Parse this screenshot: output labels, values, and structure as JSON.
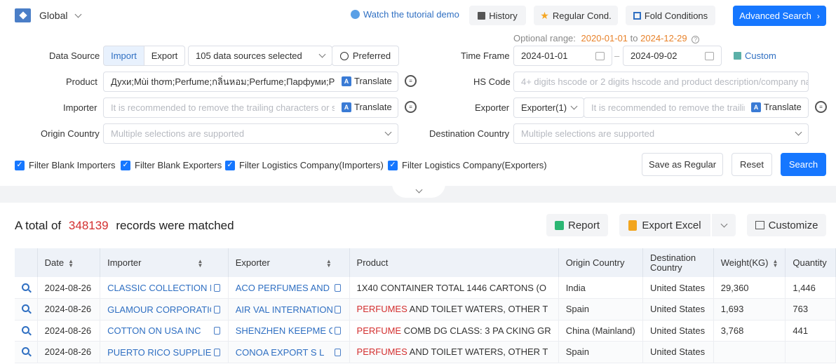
{
  "topbar": {
    "region": "Global",
    "tutorial": "Watch the tutorial demo",
    "history": "History",
    "regular": "Regular Cond.",
    "fold": "Fold Conditions",
    "advanced": "Advanced Search"
  },
  "range": {
    "label": "Optional range:",
    "start": "2020-01-01",
    "to": "to",
    "end": "2024-12-29"
  },
  "form": {
    "data_source_label": "Data Source",
    "import_tab": "Import",
    "export_tab": "Export",
    "sources_selected": "105 data sources selected",
    "preferred": "Preferred",
    "time_frame_label": "Time Frame",
    "date_from": "2024-01-01",
    "date_sep": "–",
    "date_to": "2024-09-02",
    "custom": "Custom",
    "product_label": "Product",
    "product_value": "Духи;Mùi thơm;Perfume;กลิ่นหอม;Perfume;Парфуми;Perfu",
    "translate": "Translate",
    "hs_label": "HS Code",
    "hs_placeholder": "4+ digits hscode or 2 digits hscode and product description/company na...",
    "importer_label": "Importer",
    "importer_placeholder": "It is recommended to remove the trailing characters or spe",
    "exporter_label": "Exporter",
    "exporter_select": "Exporter(1)",
    "exporter_placeholder": "It is recommended to remove the trailing",
    "origin_label": "Origin Country",
    "origin_placeholder": "Multiple selections are supported",
    "dest_label": "Destination Country",
    "dest_placeholder": "Multiple selections are supported"
  },
  "filters": {
    "blank_importers": "Filter Blank Importers",
    "blank_exporters": "Filter Blank Exporters",
    "logistics_importers": "Filter Logistics Company(Importers)",
    "logistics_exporters": "Filter Logistics Company(Exporters)",
    "save_regular": "Save as Regular",
    "reset": "Reset",
    "search": "Search"
  },
  "results": {
    "prefix": "A total of",
    "count": "348139",
    "suffix": "records were matched",
    "report": "Report",
    "export_excel": "Export Excel",
    "customize": "Customize"
  },
  "table": {
    "headers": {
      "date": "Date",
      "importer": "Importer",
      "exporter": "Exporter",
      "product": "Product",
      "origin": "Origin Country",
      "destination": "Destination Country",
      "weight": "Weight(KG)",
      "quantity": "Quantity"
    },
    "rows": [
      {
        "date": "2024-08-26",
        "importer": "CLASSIC COLLECTION FR",
        "exporter": "ACO PERFUMES AND C",
        "product_hl": "",
        "product_rest": "1X40 CONTAINER TOTAL 1446 CARTONS (O",
        "origin": "India",
        "destination": "United States",
        "weight": "29,360",
        "quantity": "1,446"
      },
      {
        "date": "2024-08-26",
        "importer": "GLAMOUR CORPORATION",
        "exporter": "AIR VAL INTERNATIONA",
        "product_hl": "PERFUMES",
        "product_rest": " AND TOILET WATERS, OTHER T",
        "origin": "Spain",
        "destination": "United States",
        "weight": "1,693",
        "quantity": "763"
      },
      {
        "date": "2024-08-26",
        "importer": "COTTON ON USA INC",
        "exporter": "SHENZHEN KEEPME CO",
        "product_hl": "PERFUME",
        "product_rest": " COMB DG CLASS: 3 PA CKING GR",
        "origin": "China (Mainland)",
        "destination": "United States",
        "weight": "3,768",
        "quantity": "441"
      },
      {
        "date": "2024-08-26",
        "importer": "PUERTO RICO SUPPLIES",
        "exporter": "CONOA EXPORT S L",
        "product_hl": "PERFUMES",
        "product_rest": " AND TOILET WATERS, OTHER T",
        "origin": "Spain",
        "destination": "United States",
        "weight": "",
        "quantity": ""
      }
    ]
  }
}
